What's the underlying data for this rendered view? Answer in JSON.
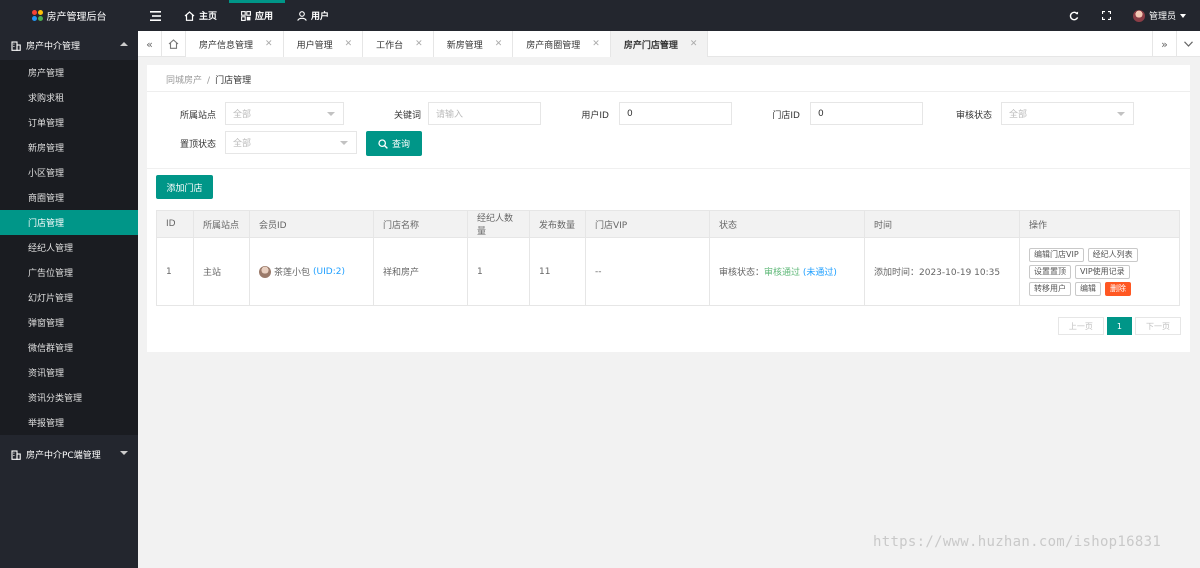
{
  "app": {
    "title": "房产管理后台",
    "logo_colors": [
      "#f44336",
      "#ffc107",
      "#4caf50",
      "#2196f3"
    ]
  },
  "topnav": {
    "items": [
      {
        "label": "主页",
        "icon": "home-icon"
      },
      {
        "label": "应用",
        "icon": "apps-icon"
      },
      {
        "label": "用户",
        "icon": "user-icon"
      }
    ],
    "active": "应用",
    "user_label": "管理员"
  },
  "sidebar": {
    "group1": {
      "label": "房产中介管理",
      "expanded": true
    },
    "items": [
      {
        "label": "房产管理"
      },
      {
        "label": "求购求租"
      },
      {
        "label": "订单管理"
      },
      {
        "label": "新房管理"
      },
      {
        "label": "小区管理"
      },
      {
        "label": "商圈管理"
      },
      {
        "label": "门店管理"
      },
      {
        "label": "经纪人管理"
      },
      {
        "label": "广告位管理"
      },
      {
        "label": "幻灯片管理"
      },
      {
        "label": "弹窗管理"
      },
      {
        "label": "微信群管理"
      },
      {
        "label": "资讯管理"
      },
      {
        "label": "资讯分类管理"
      },
      {
        "label": "举报管理"
      }
    ],
    "active_item": "门店管理",
    "group2": {
      "label": "房产中介PC端管理",
      "expanded": false
    }
  },
  "tabs": [
    {
      "label": "房产信息管理",
      "active": false
    },
    {
      "label": "用户管理",
      "active": false
    },
    {
      "label": "工作台",
      "active": false
    },
    {
      "label": "新房管理",
      "active": false
    },
    {
      "label": "房产商圈管理",
      "active": false
    },
    {
      "label": "房产门店管理",
      "active": true
    }
  ],
  "breadcrumb": {
    "parent": "同城房产",
    "separator": "/",
    "current": "门店管理"
  },
  "filters": {
    "site": {
      "label": "所属站点",
      "value": "全部"
    },
    "keyword": {
      "label": "关键词",
      "placeholder": "请输入"
    },
    "user_id": {
      "label": "用户ID",
      "value": "0"
    },
    "store_id": {
      "label": "门店ID",
      "value": "0"
    },
    "review": {
      "label": "审核状态",
      "value": "全部"
    },
    "top": {
      "label": "置顶状态",
      "value": "全部"
    },
    "search_button": "查询"
  },
  "add_button": "添加门店",
  "table": {
    "headers": [
      "ID",
      "所属站点",
      "会员ID",
      "门店名称",
      "经纪人数量",
      "发布数量",
      "门店VIP",
      "状态",
      "时间",
      "操作"
    ],
    "rows": [
      {
        "id": "1",
        "site": "主站",
        "member_name": "茶莲小包",
        "member_uid": "(UID:2)",
        "store_name": "祥和房产",
        "agent_count": "1",
        "post_count": "11",
        "vip": "--",
        "status_prefix": "审核状态：",
        "status_ok": "审核通过",
        "status_alt": "(未通过)",
        "time": "添加时间：2023-10-19 10:35",
        "actions": [
          "编辑门店VIP",
          "经纪人列表",
          "设置置顶",
          "VIP使用记录",
          "转移用户",
          "编辑",
          "删除"
        ]
      }
    ]
  },
  "pager": {
    "prev": "上一页",
    "current": "1",
    "next": "下一页"
  },
  "watermark": "https://www.huzhan.com/ishop16831"
}
